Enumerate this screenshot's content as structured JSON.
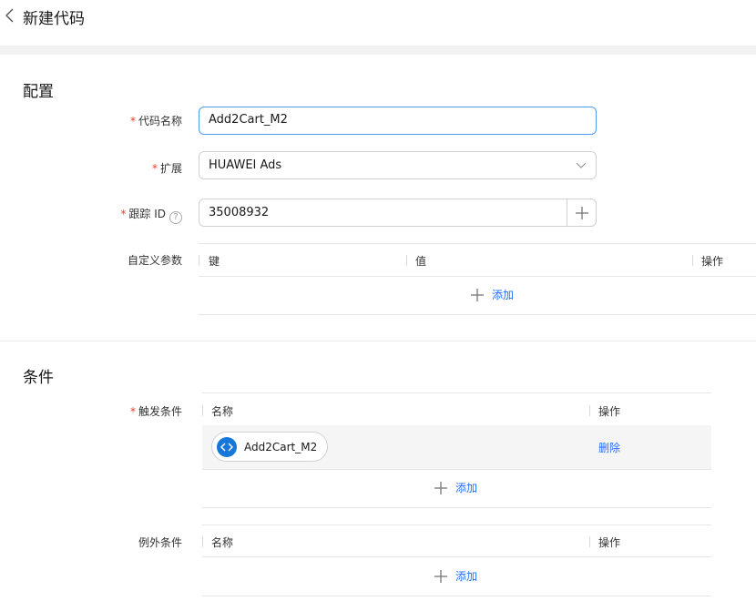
{
  "header": {
    "title": "新建代码",
    "back_icon": "chevron-left-icon"
  },
  "config": {
    "title": "配置",
    "code_name": {
      "label": "代码名称",
      "required": true,
      "value": "Add2Cart_M2"
    },
    "extension": {
      "label": "扩展",
      "required": true,
      "selected": "HUAWEI Ads",
      "icon": "chevron-down-icon"
    },
    "tracking_id": {
      "label": "跟踪 ID",
      "required": true,
      "help": "?",
      "value": "35008932",
      "add_icon": "plus-icon"
    },
    "custom_params": {
      "label": "自定义参数",
      "columns": [
        "键",
        "值",
        "操作"
      ],
      "add_label": "添加"
    }
  },
  "conditions": {
    "title": "条件",
    "trigger": {
      "label": "触发条件",
      "required": true,
      "columns": [
        "名称",
        "操作"
      ],
      "rows": [
        {
          "name": "Add2Cart_M2",
          "icon": "code-icon",
          "action": "删除"
        }
      ],
      "add_label": "添加"
    },
    "exception": {
      "label": "例外条件",
      "columns": [
        "名称",
        "操作"
      ],
      "add_label": "添加"
    }
  },
  "colors": {
    "accent": "#256fff",
    "required": "#e84026",
    "focus": "#4e9bf0",
    "chip_icon": "#1677d9"
  }
}
